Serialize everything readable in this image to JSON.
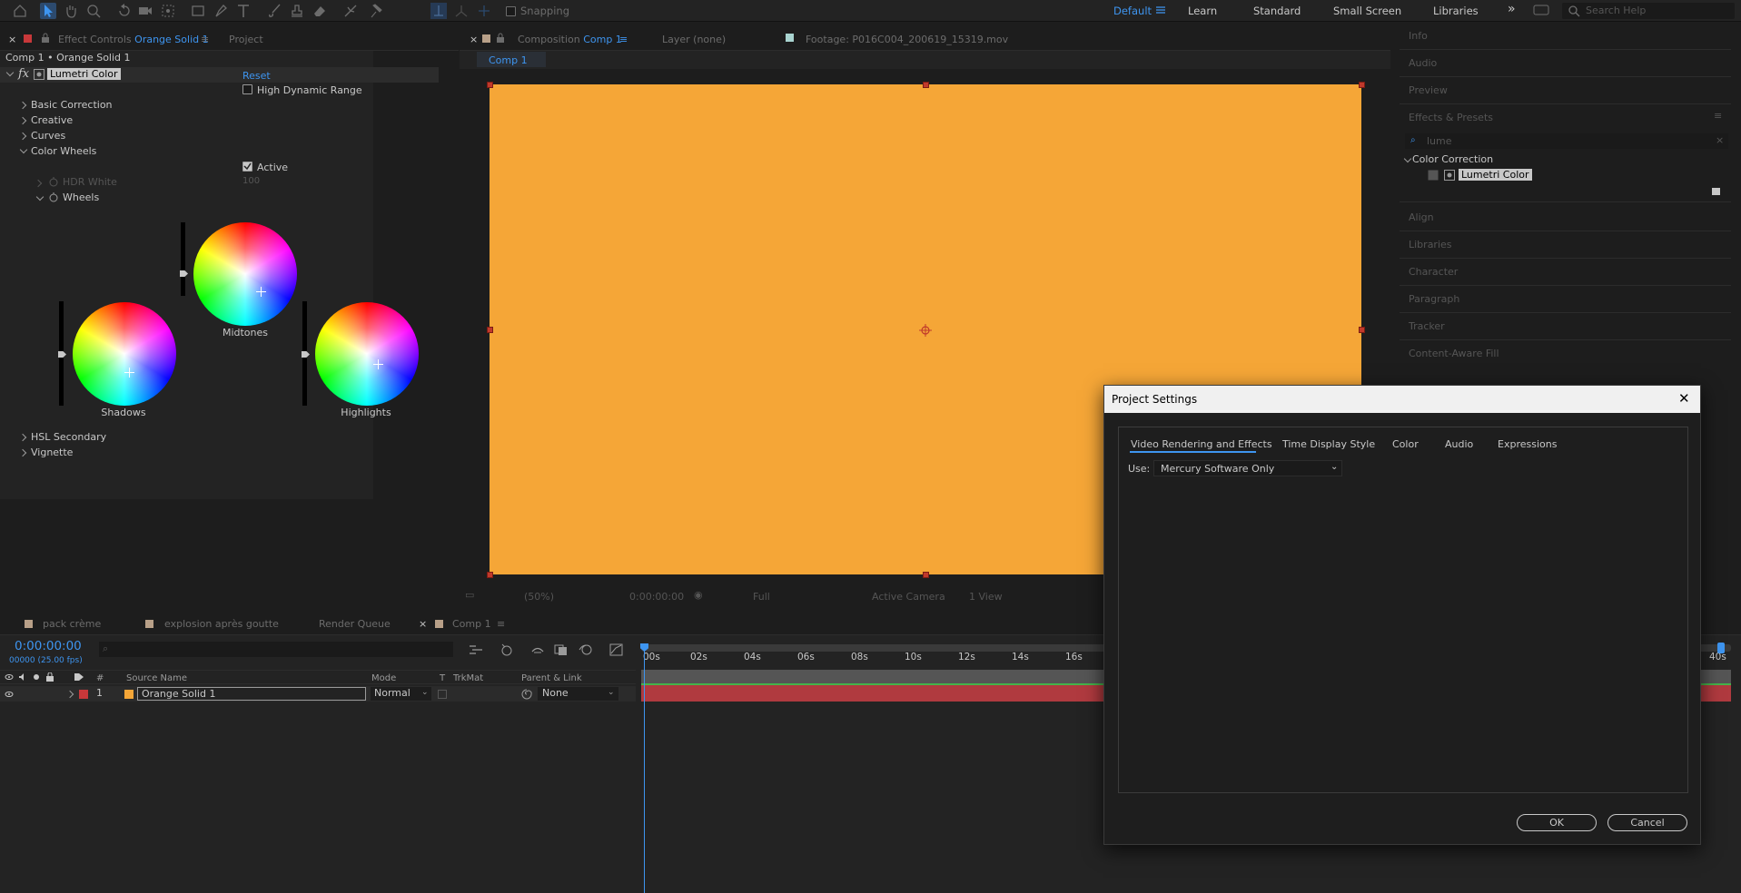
{
  "toolbar": {
    "snapping": "Snapping",
    "workspaces": [
      "Default",
      "Learn",
      "Standard",
      "Small Screen",
      "Libraries"
    ],
    "more": "»",
    "search_placeholder": "Search Help"
  },
  "effect_controls": {
    "tab_prefix": "Effect Controls",
    "tab_layer": "Orange Solid 1",
    "tab_project": "Project",
    "breadcrumb": "Comp 1 • Orange Solid 1",
    "fx_label": "fx",
    "effect_name": "Lumetri Color",
    "reset": "Reset",
    "hdr_label": "High Dynamic Range",
    "groups": [
      "Basic Correction",
      "Creative",
      "Curves",
      "Color Wheels"
    ],
    "active_label": "Active",
    "hdr_white": "HDR White",
    "hdr_white_value": "100",
    "wheels_label": "Wheels",
    "wheel_shadows": "Shadows",
    "wheel_midtones": "Midtones",
    "wheel_highlights": "Highlights",
    "groups_after": [
      "HSL Secondary",
      "Vignette"
    ]
  },
  "comp_viewer": {
    "tab_prefix": "Composition",
    "tab_comp": "Comp 1",
    "layer_tab": "Layer (none)",
    "footage_tab": "Footage: P016C004_200619_15319.mov",
    "breadcrumb": "Comp 1",
    "canvas_color": "#f5a637",
    "zoom": "(50%)",
    "timecode": "0:00:00:00",
    "resolution": "Full",
    "camera": "Active Camera",
    "views": "1 View"
  },
  "right_panels": {
    "items": [
      "Info",
      "Audio",
      "Preview",
      "Effects & Presets"
    ],
    "search_value": "lume",
    "category": "Color Correction",
    "effect": "Lumetri Color",
    "items_after": [
      "Align",
      "Libraries",
      "Character",
      "Paragraph",
      "Tracker",
      "Content-Aware Fill"
    ]
  },
  "timeline": {
    "tabs": [
      "pack crème",
      "explosion après goutte",
      "Render Queue",
      "Comp 1"
    ],
    "timecode": "0:00:00:00",
    "fps": "00000 (25.00 fps)",
    "columns": {
      "hash": "#",
      "source": "Source Name",
      "mode": "Mode",
      "t": "T",
      "trkmat": "TrkMat",
      "parent": "Parent & Link"
    },
    "layer": {
      "index": "1",
      "name": "Orange Solid 1",
      "mode": "Normal",
      "parent": "None"
    },
    "ruler": [
      "00s",
      "02s",
      "04s",
      "06s",
      "08s",
      "10s",
      "12s",
      "14s",
      "16s",
      "40s"
    ]
  },
  "dialog": {
    "title": "Project Settings",
    "close": "✕",
    "tabs": [
      "Video Rendering and Effects",
      "Time Display Style",
      "Color",
      "Audio",
      "Expressions"
    ],
    "use_label": "Use:",
    "renderer": "Mercury Software Only",
    "ok": "OK",
    "cancel": "Cancel"
  },
  "colors": {
    "accent": "#3e95f0",
    "orange": "#f5a637",
    "label_red": "#c8383a"
  }
}
